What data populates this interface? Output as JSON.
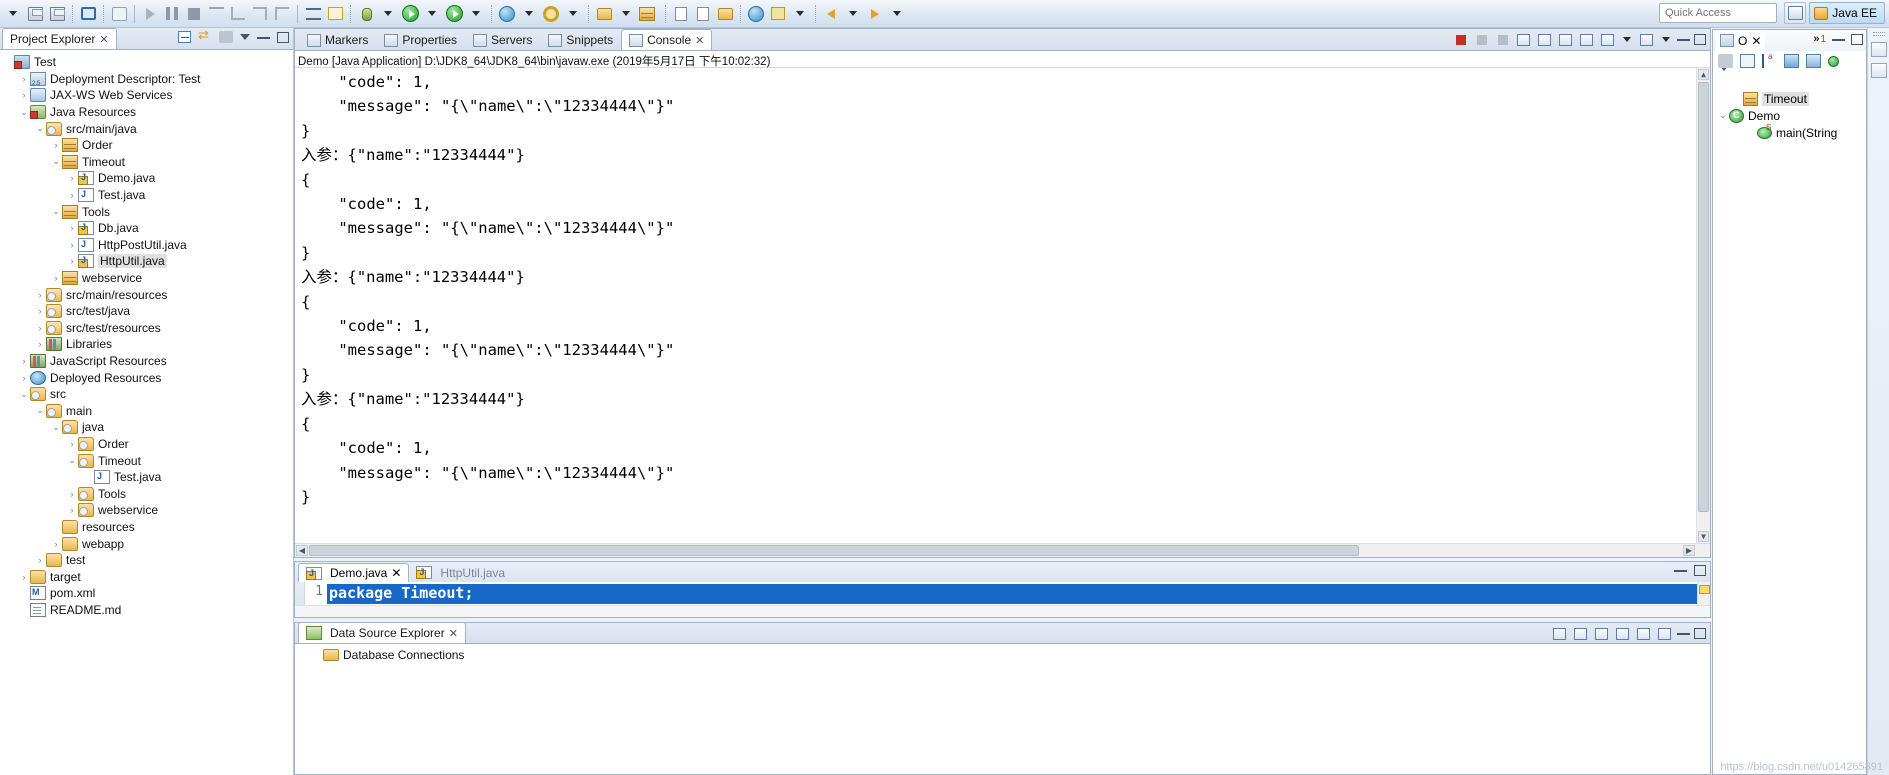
{
  "toolbar": {
    "quick_access_placeholder": "Quick Access",
    "perspective_label": "Java EE",
    "items": [
      {
        "name": "new-wizard-dropdown",
        "icon": "chevron-down-icon"
      },
      {
        "name": "save-button",
        "icon": "save-icon"
      },
      {
        "name": "save-all-button",
        "icon": "save-all-icon"
      },
      {
        "name": "console-button",
        "icon": "console-icon"
      },
      {
        "name": "skip-breakpoints-button",
        "icon": "skip-breakpoints-icon"
      },
      {
        "name": "resume-button",
        "icon": "resume-icon"
      },
      {
        "name": "suspend-button",
        "icon": "suspend-icon"
      },
      {
        "name": "terminate-button",
        "icon": "terminate-icon"
      },
      {
        "name": "disconnect-button",
        "icon": "disconnect-icon"
      },
      {
        "name": "step-into-button",
        "icon": "step-into-icon"
      },
      {
        "name": "step-over-button",
        "icon": "step-over-icon"
      },
      {
        "name": "step-return-button",
        "icon": "step-return-icon"
      },
      {
        "name": "run-last-tool-button",
        "icon": "run-last-icon"
      },
      {
        "name": "external-tools-button",
        "icon": "external-tools-icon"
      },
      {
        "name": "debug-button",
        "icon": "debug-icon"
      },
      {
        "name": "run-button",
        "icon": "run-icon"
      },
      {
        "name": "run-as-server-button",
        "icon": "run-server-icon"
      },
      {
        "name": "new-server-button",
        "icon": "new-server-icon"
      },
      {
        "name": "open-type-button",
        "icon": "open-type-icon"
      },
      {
        "name": "search-button",
        "icon": "search-icon"
      },
      {
        "name": "next-annotation-button",
        "icon": "next-annotation-icon"
      },
      {
        "name": "previous-annotation-button",
        "icon": "previous-annotation-icon"
      },
      {
        "name": "back-button",
        "icon": "back-arrow-icon"
      },
      {
        "name": "forward-button",
        "icon": "forward-arrow-icon"
      }
    ]
  },
  "project_explorer": {
    "title": "Project Explorer",
    "close_glyph": "✕",
    "tree": [
      {
        "label": "Test",
        "indent": 0,
        "twist": "none",
        "icon": "i-proj"
      },
      {
        "label": "Deployment Descriptor: Test",
        "indent": 1,
        "twist": "right",
        "icon": "i-dd"
      },
      {
        "label": "JAX-WS Web Services",
        "indent": 1,
        "twist": "right",
        "icon": "i-ws"
      },
      {
        "label": "Java Resources",
        "indent": 1,
        "twist": "down",
        "icon": "i-jres"
      },
      {
        "label": "src/main/java",
        "indent": 2,
        "twist": "down",
        "icon": "i-srcf"
      },
      {
        "label": "Order",
        "indent": 3,
        "twist": "right",
        "icon": "i-pkg"
      },
      {
        "label": "Timeout",
        "indent": 3,
        "twist": "down",
        "icon": "i-pkg"
      },
      {
        "label": "Demo.java",
        "indent": 4,
        "twist": "right",
        "icon": "i-java warn"
      },
      {
        "label": "Test.java",
        "indent": 4,
        "twist": "right",
        "icon": "i-java"
      },
      {
        "label": "Tools",
        "indent": 3,
        "twist": "down",
        "icon": "i-pkg"
      },
      {
        "label": "Db.java",
        "indent": 4,
        "twist": "right",
        "icon": "i-java warn"
      },
      {
        "label": "HttpPostUtil.java",
        "indent": 4,
        "twist": "right",
        "icon": "i-java"
      },
      {
        "label": "HttpUtil.java",
        "indent": 4,
        "twist": "right",
        "icon": "i-java warn",
        "selected": true
      },
      {
        "label": "webservice",
        "indent": 3,
        "twist": "right",
        "icon": "i-pkg"
      },
      {
        "label": "src/main/resources",
        "indent": 2,
        "twist": "right",
        "icon": "i-srcf"
      },
      {
        "label": "src/test/java",
        "indent": 2,
        "twist": "right",
        "icon": "i-srcf"
      },
      {
        "label": "src/test/resources",
        "indent": 2,
        "twist": "right",
        "icon": "i-srcf"
      },
      {
        "label": "Libraries",
        "indent": 2,
        "twist": "right",
        "icon": "i-lib"
      },
      {
        "label": "JavaScript Resources",
        "indent": 1,
        "twist": "right",
        "icon": "i-lib"
      },
      {
        "label": "Deployed Resources",
        "indent": 1,
        "twist": "right",
        "icon": "i-depres"
      },
      {
        "label": "src",
        "indent": 1,
        "twist": "down",
        "icon": "i-folder src"
      },
      {
        "label": "main",
        "indent": 2,
        "twist": "down",
        "icon": "i-folder src"
      },
      {
        "label": "java",
        "indent": 3,
        "twist": "down",
        "icon": "i-folder src"
      },
      {
        "label": "Order",
        "indent": 4,
        "twist": "right",
        "icon": "i-folder src"
      },
      {
        "label": "Timeout",
        "indent": 4,
        "twist": "down",
        "icon": "i-folder src"
      },
      {
        "label": "Test.java",
        "indent": 5,
        "twist": "none",
        "icon": "i-java"
      },
      {
        "label": "Tools",
        "indent": 4,
        "twist": "right",
        "icon": "i-folder src"
      },
      {
        "label": "webservice",
        "indent": 4,
        "twist": "right",
        "icon": "i-folder src"
      },
      {
        "label": "resources",
        "indent": 3,
        "twist": "none",
        "icon": "i-folder"
      },
      {
        "label": "webapp",
        "indent": 3,
        "twist": "right",
        "icon": "i-folder"
      },
      {
        "label": "test",
        "indent": 2,
        "twist": "right",
        "icon": "i-folder"
      },
      {
        "label": "target",
        "indent": 1,
        "twist": "right",
        "icon": "i-folder"
      },
      {
        "label": "pom.xml",
        "indent": 1,
        "twist": "none",
        "icon": "i-pom"
      },
      {
        "label": "README.md",
        "indent": 1,
        "twist": "none",
        "icon": "i-md"
      }
    ]
  },
  "console_panel": {
    "tabs": [
      {
        "label": "Markers",
        "icon": "markers-icon",
        "active": false
      },
      {
        "label": "Properties",
        "icon": "properties-icon",
        "active": false
      },
      {
        "label": "Servers",
        "icon": "servers-icon",
        "active": false
      },
      {
        "label": "Snippets",
        "icon": "snippets-icon",
        "active": false
      },
      {
        "label": "Console",
        "icon": "console-icon",
        "active": true
      }
    ],
    "close_glyph": "✕",
    "launch_title": "Demo [Java Application] D:\\JDK8_64\\JDK8_64\\bin\\javaw.exe (2019年5月17日 下午10:02:32)",
    "lines": [
      "    \"code\": 1,",
      "    \"message\": \"{\\\"name\\\":\\\"12334444\\\"}\"",
      "}",
      "入参：{\"name\":\"12334444\"}",
      "{",
      "    \"code\": 1,",
      "    \"message\": \"{\\\"name\\\":\\\"12334444\\\"}\"",
      "}",
      "入参：{\"name\":\"12334444\"}",
      "{",
      "    \"code\": 1,",
      "    \"message\": \"{\\\"name\\\":\\\"12334444\\\"}\"",
      "}",
      "入参：{\"name\":\"12334444\"}",
      "{",
      "    \"code\": 1,",
      "    \"message\": \"{\\\"name\\\":\\\"12334444\\\"}\"",
      "}"
    ]
  },
  "editor": {
    "tabs": [
      {
        "label": "Demo.java",
        "active": true,
        "close_glyph": "✕"
      },
      {
        "label": "HttpUtil.java",
        "active": false,
        "close_glyph": ""
      }
    ],
    "line_number": "1",
    "code_line": "package Timeout;"
  },
  "data_source_explorer": {
    "title": "Data Source Explorer",
    "close_glyph": "✕",
    "node": "Database Connections"
  },
  "outline": {
    "title_glyph": "O",
    "close_glyph": "✕",
    "overflow_glyph": "»",
    "overflow_count": "1",
    "items": [
      {
        "label": "Timeout",
        "indent": 1,
        "twist": "none",
        "icon": "i-pkgo",
        "selected": true
      },
      {
        "label": "Demo",
        "indent": 0,
        "twist": "down",
        "icon": "i-class"
      },
      {
        "label": "main(String",
        "indent": 2,
        "twist": "none",
        "icon": "i-method"
      }
    ]
  },
  "watermark": "https://blog.csdn.net/u014265891"
}
